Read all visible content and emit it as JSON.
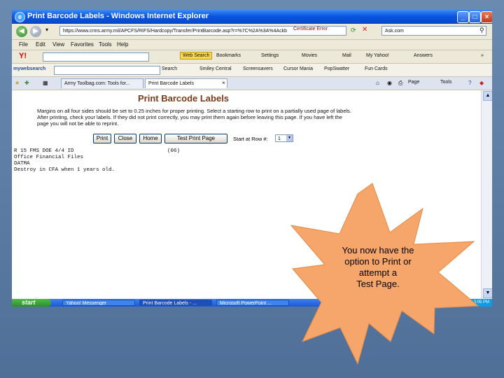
{
  "window": {
    "title": "Print Barcode Labels - Windows Internet Explorer"
  },
  "nav": {
    "address": "https://www.crms.army.mil/APCFS/RIFS/Hardcopy/Transfer/PrintBarcode.asp?r=%7C%2A%3A%4Ackb",
    "cert_error": "Certificate Error",
    "search_value": "Ask.com"
  },
  "menu": {
    "items": [
      "File",
      "Edit",
      "View",
      "Favorites",
      "Tools",
      "Help"
    ]
  },
  "yahoo": {
    "logo": "Y!",
    "web_search": "Web Search",
    "items": [
      "Bookmarks",
      "Settings",
      "Movies",
      "Mail",
      "My Yahoo!",
      "Answers"
    ]
  },
  "mywebsearch": {
    "label": "mywebsearch",
    "items": [
      "Search",
      "Smiley Central",
      "Screensavers",
      "Cursor Mania",
      "PopSwatter",
      "Fun Cards"
    ]
  },
  "tabs": {
    "items": [
      {
        "label": "Army Toolbag.com: Tools for..."
      },
      {
        "label": "Print Barcode Labels"
      }
    ],
    "tools": [
      "Page",
      "Tools"
    ]
  },
  "page": {
    "heading": "Print Barcode Labels",
    "instructions": "Margins on all four sides should be set to 0.25 inches for proper printing. Select a starting row to print on a partially used page of labels. After printing, check your labels. If they did not print correctly, you may print them again before leaving this page. If you have left the page you will not be able to reprint.",
    "buttons": {
      "print": "Print",
      "close": "Close",
      "home": "Home",
      "test": "Test Print Page"
    },
    "start_row_label": "Start at Row #:",
    "start_row_value": "1",
    "label_lines": [
      "R 15 FMS DOE 4/4 ID",
      "Office Financial Files",
      "DATMA",
      "Destroy in CFA when 1 years old."
    ],
    "label_code": "(06)"
  },
  "taskbar": {
    "start": "start",
    "items": [
      "Yahoo! Messenger",
      "Print Barcode Labels - ...",
      "Microsoft PowerPoint ..."
    ],
    "clock": "3:05 PM"
  },
  "callout": {
    "lines": [
      "You now have the",
      "option to Print or",
      "attempt a",
      "Test Page."
    ]
  }
}
